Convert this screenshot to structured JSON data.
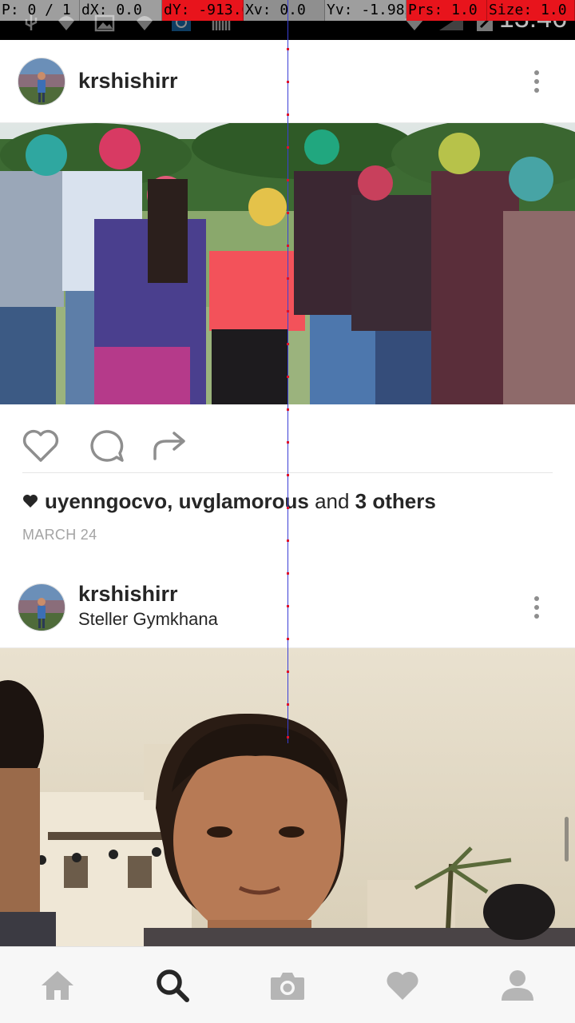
{
  "pointer_overlay": {
    "pointer": "P: 0 / 1",
    "dx": "dX: 0.0",
    "dy": "dY: -913.0",
    "xv": "Xv: 0.0",
    "yv": "Yv: -1.982",
    "prs": "Prs: 1.0",
    "size": "Size: 1.0"
  },
  "status_bar": {
    "time": "13:46"
  },
  "posts": [
    {
      "username": "krshishirr",
      "location": "",
      "likes": {
        "user1": "uyenngocvo",
        "separator": ", ",
        "user2": "uvglamorous",
        "and_text": " and ",
        "others": "3 others"
      },
      "date": "MARCH 24"
    },
    {
      "username": "krshishirr",
      "location": "Steller Gymkhana"
    }
  ],
  "bottom_nav": [
    "home-icon",
    "search-icon",
    "camera-icon",
    "heart-icon",
    "profile-icon"
  ],
  "colors": {
    "accent_text": "#262626",
    "muted_text": "#a4a4a4",
    "nav_icon_inactive": "#b5b5b5",
    "nav_icon_active": "#262626",
    "pointer_red": "#e8141c",
    "pointer_trace": "#3b3fd6"
  }
}
